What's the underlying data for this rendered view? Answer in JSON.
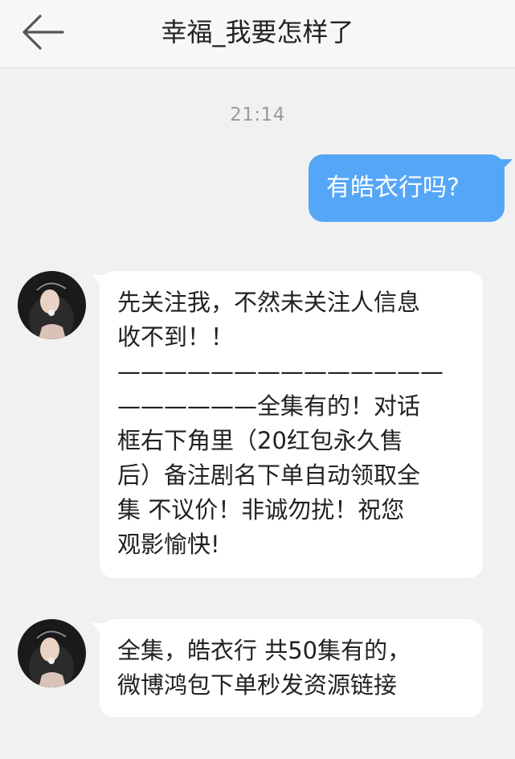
{
  "header": {
    "title": "幸福_我要怎样了",
    "back_icon": "arrow-left-icon"
  },
  "timestamp": "21:14",
  "colors": {
    "outgoing_bubble": "#56a6f7",
    "incoming_bubble": "#ffffff",
    "background": "#f1f1f1"
  },
  "messages": [
    {
      "direction": "outgoing",
      "lines": [
        "有皓衣行吗?"
      ]
    },
    {
      "direction": "incoming",
      "avatar": "contact-avatar",
      "lines": [
        "先关注我，不然未关注人信息",
        "收不到！！",
        " ——————————————",
        "——————全集有的！对话",
        "框右下角里（20红包永久售",
        "后）备注剧名下单自动领取全",
        "集 不议价！非诚勿扰！祝您",
        "观影愉快!"
      ]
    },
    {
      "direction": "incoming",
      "avatar": "contact-avatar",
      "lines": [
        "全集，皓衣行 共50集有的，",
        "微博鸿包下单秒发资源链接"
      ]
    }
  ]
}
